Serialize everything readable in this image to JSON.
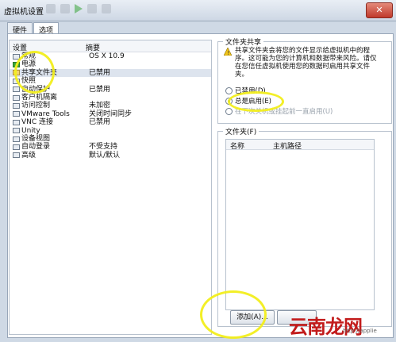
{
  "window": {
    "title": "虚拟机设置",
    "close": "✕"
  },
  "tabs": [
    {
      "label": "硬件",
      "active": false
    },
    {
      "label": "选项",
      "active": true
    }
  ],
  "settings_list": {
    "headers": [
      "设置",
      "摘要"
    ],
    "rows": [
      {
        "name": "常规",
        "summary": "OS X 10.9",
        "icon": "gear-icon"
      },
      {
        "name": "电源",
        "summary": "",
        "icon": "play-icon"
      },
      {
        "name": "共享文件夹",
        "summary": "已禁用",
        "icon": "folder-icon"
      },
      {
        "name": "快照",
        "summary": "",
        "icon": "camera-icon"
      },
      {
        "name": "自动保护",
        "summary": "已禁用",
        "icon": "clock-icon"
      },
      {
        "name": "客户机隔离",
        "summary": "",
        "icon": "lock-icon"
      },
      {
        "name": "访问控制",
        "summary": "未加密",
        "icon": "key-icon"
      },
      {
        "name": "VMware Tools",
        "summary": "关闭时间同步",
        "icon": "tools-icon"
      },
      {
        "name": "VNC 连接",
        "summary": "已禁用",
        "icon": "monitor-icon"
      },
      {
        "name": "Unity",
        "summary": "",
        "icon": "unity-icon"
      },
      {
        "name": "设备视图",
        "summary": "",
        "icon": "device-view-icon"
      },
      {
        "name": "自动登录",
        "summary": "不受支持",
        "icon": "user-icon"
      },
      {
        "name": "高级",
        "summary": "默认/默认",
        "icon": "advanced-icon"
      }
    ]
  },
  "sharing": {
    "title": "文件夹共享",
    "warning": "共享文件夹会将您的文件显示给虚拟机中的程序。这可能为您的计算机和数据带来风险。请仅在您信任虚拟机使用您的数据时启用共享文件夹。",
    "options": [
      {
        "label": "已禁用(D)",
        "checked": false,
        "disabled": false
      },
      {
        "label": "总是启用(E)",
        "checked": true,
        "disabled": false
      },
      {
        "label": "在下次关机或挂起前一直启用(U)",
        "checked": false,
        "disabled": true
      }
    ]
  },
  "folders": {
    "title": "文件夹(F)",
    "headers": [
      "名称",
      "主机路径"
    ],
    "add_button": "添加(A)..."
  },
  "watermark": {
    "text": "云南龙网",
    "small": "http://applie"
  }
}
